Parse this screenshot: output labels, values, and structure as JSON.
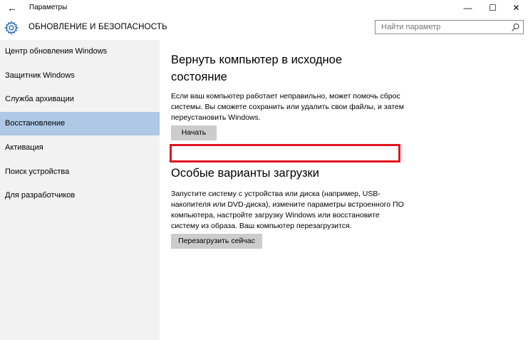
{
  "window": {
    "back_glyph": "←",
    "title": "Параметры",
    "minimize_glyph": "—",
    "maximize_glyph": "☐",
    "close_glyph": "✕"
  },
  "header": {
    "icon": "gear-icon",
    "title": "ОБНОВЛЕНИЕ И БЕЗОПАСНОСТЬ",
    "search_placeholder": "Найти параметр",
    "search_icon": "search-icon"
  },
  "sidebar": {
    "items": [
      {
        "label": "Центр обновления Windows"
      },
      {
        "label": "Защитник Windows"
      },
      {
        "label": "Служба архивации"
      },
      {
        "label": "Восстановление",
        "active": true
      },
      {
        "label": "Активация"
      },
      {
        "label": "Поиск устройства"
      },
      {
        "label": "Для разработчиков"
      }
    ]
  },
  "reset": {
    "title": "Вернуть компьютер в исходное состояние",
    "description": "Если ваш компьютер работает неправильно, может помочь сброс системы. Вы сможете сохранить или удалить свои файлы, и затем переустановить Windows.",
    "button": "Начать"
  },
  "advanced": {
    "title": "Особые варианты загрузки",
    "description": "Запустите систему с устройства или диска (например, USB-накопителя или DVD-диска), измените параметры встроенного ПО компьютера, настройте загрузку Windows или восстановите систему из образа. Ваш компьютер перезагрузится.",
    "button": "Перезагрузить сейчас"
  },
  "colors": {
    "sidebar_bg": "#f2f2f2",
    "active_item": "#aec8e6",
    "button_bg": "#cccccc",
    "highlight_box": "#e0141e"
  }
}
